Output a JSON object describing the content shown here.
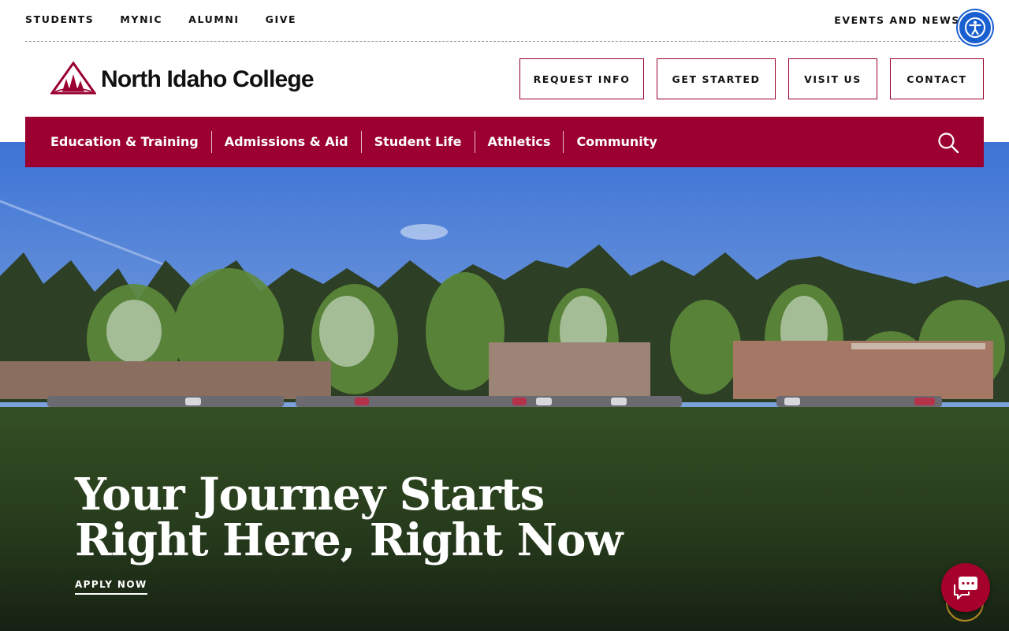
{
  "utility_nav": {
    "left": [
      "STUDENTS",
      "MYNIC",
      "ALUMNI",
      "GIVE"
    ],
    "right": "EVENTS AND NEWS"
  },
  "brand": {
    "name": "North Idaho College",
    "color": "#9b0030"
  },
  "cta_buttons": [
    "REQUEST INFO",
    "GET STARTED",
    "VISIT US",
    "CONTACT"
  ],
  "main_nav": [
    "Education & Training",
    "Admissions & Aid",
    "Student Life",
    "Athletics",
    "Community"
  ],
  "hero": {
    "title_line1": "Your Journey Starts",
    "title_line2": "Right Here, Right Now",
    "link": "APPLY NOW"
  },
  "icons": {
    "accessibility": "accessibility-icon",
    "search": "search-icon",
    "chat": "chat-icon"
  }
}
